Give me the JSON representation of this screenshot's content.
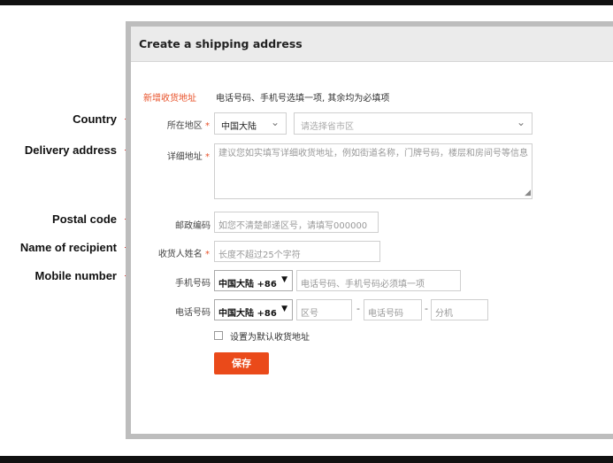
{
  "window": {
    "title": "Create a shipping address"
  },
  "form": {
    "section_title": "新增收货地址",
    "section_note": "电话号码、手机号选填一项, 其余均为必填项",
    "required_mark": "*",
    "region": {
      "label": "所在地区",
      "country_value": "中国大陆",
      "city_placeholder": "请选择省市区"
    },
    "address": {
      "label": "详细地址",
      "placeholder": "建议您如实填写详细收货地址，例如街道名称，门牌号码，楼层和房间号等信息"
    },
    "postal": {
      "label": "邮政编码",
      "placeholder": "如您不清楚邮递区号，请填写000000"
    },
    "recipient": {
      "label": "收货人姓名",
      "placeholder": "长度不超过25个字符"
    },
    "mobile": {
      "label": "手机号码",
      "code_value": "中国大陆 +86",
      "placeholder": "电话号码、手机号码必须填一项"
    },
    "phone": {
      "label": "电话号码",
      "code_value": "中国大陆 +86",
      "area_placeholder": "区号",
      "number_placeholder": "电话号码",
      "ext_placeholder": "分机",
      "separator": "-"
    },
    "default_checkbox_label": "设置为默认收货地址",
    "save_label": "保存"
  },
  "annotations": {
    "country": "Country",
    "delivery": "Delivery address",
    "postal": "Postal code",
    "recipient": "Name of recipient",
    "mobile": "Mobile number"
  },
  "colors": {
    "accent": "#e8522a",
    "button": "#ea4a1a",
    "arrow": "#e0302a",
    "header_bg": "#ebebeb",
    "frame": "#bdbdbd"
  },
  "icons": {
    "select": "chevron-down-icon",
    "code_select": "triangle-down-icon",
    "resize": "resize-grip-icon"
  }
}
